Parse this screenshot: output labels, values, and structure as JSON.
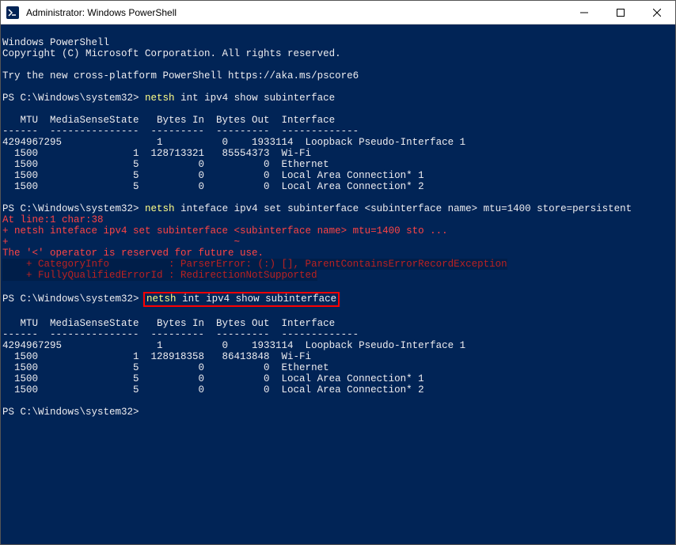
{
  "window": {
    "title": "Administrator: Windows PowerShell"
  },
  "header": {
    "line1": "Windows PowerShell",
    "line2": "Copyright (C) Microsoft Corporation. All rights reserved.",
    "line3": "Try the new cross-platform PowerShell https://aka.ms/pscore6"
  },
  "prompt": "PS C:\\Windows\\system32>",
  "cmd1": {
    "netsh": "netsh",
    "rest": " int ipv4 show subinterface"
  },
  "table_header": "   MTU  MediaSenseState   Bytes In  Bytes Out  Interface",
  "table1": {
    "r0": "4294967295                1          0    1933114  Loopback Pseudo-Interface 1",
    "r1": "  1500                1  128713321   85554373  Wi-Fi",
    "r2": "  1500                5          0          0  Ethernet",
    "r3": "  1500                5          0          0  Local Area Connection* 1",
    "r4": "  1500                5          0          0  Local Area Connection* 2"
  },
  "cmd2": {
    "netsh": "netsh",
    "rest": " inteface ipv4 set subinterface <subinterface name> mtu=1400 store=persistent"
  },
  "error": {
    "e0": "At line:1 char:38",
    "e1": "+ netsh inteface ipv4 set subinterface <subinterface name> mtu=1400 sto ...",
    "e2": "+                                      ~",
    "e3": "The '<' operator is reserved for future use.",
    "e4": "    + CategoryInfo          : ParserError: (:) [], ParentContainsErrorRecordException",
    "e5": "    + FullyQualifiedErrorId : RedirectionNotSupported"
  },
  "cmd3": {
    "netsh": "netsh",
    "rest": " int ipv4 show subinterface"
  },
  "table2": {
    "r0": "4294967295                1          0    1933114  Loopback Pseudo-Interface 1",
    "r1": "  1500                1  128918358   86413848  Wi-Fi",
    "r2": "  1500                5          0          0  Ethernet",
    "r3": "  1500                5          0          0  Local Area Connection* 1",
    "r4": "  1500                5          0          0  Local Area Connection* 2"
  }
}
